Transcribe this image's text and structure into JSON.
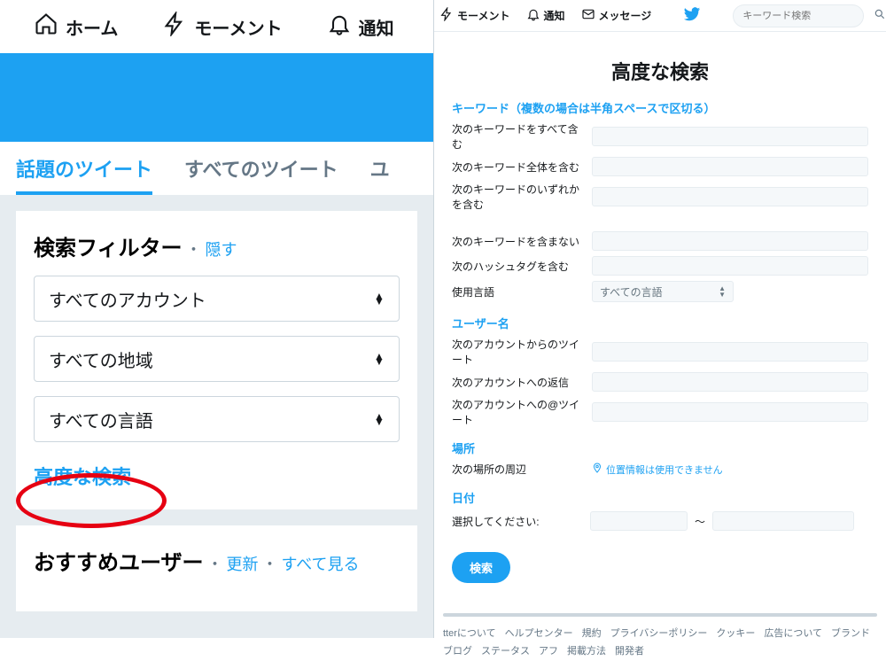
{
  "left": {
    "nav": {
      "home": "ホーム",
      "moments": "モーメント",
      "notifications": "通知"
    },
    "tabs": {
      "hot": "話題のツイート",
      "all": "すべてのツイート",
      "users_cut": "ユ"
    },
    "filter": {
      "title": "検索フィルター",
      "sep": "・",
      "hide": "隠す",
      "sel_account": "すべてのアカウント",
      "sel_region": "すべての地域",
      "sel_lang": "すべての言語",
      "advanced": "高度な検索"
    },
    "recommend": {
      "title": "おすすめユーザー",
      "sep": "・",
      "refresh": "更新",
      "viewall": "すべて見る"
    }
  },
  "right": {
    "top": {
      "moments": "モーメント",
      "notifications": "通知",
      "messages": "メッセージ",
      "search_placeholder": "キーワード検索"
    },
    "title": "高度な検索",
    "sections": {
      "keywords": "キーワード（複数の場合は半角スペースで区切る）",
      "users": "ユーザー名",
      "place": "場所",
      "date": "日付"
    },
    "fields": {
      "kw_all": "次のキーワードをすべて含む",
      "kw_exact": "次のキーワード全体を含む",
      "kw_any": "次のキーワードのいずれかを含む",
      "kw_none": "次のキーワードを含まない",
      "kw_hashtag": "次のハッシュタグを含む",
      "kw_lang": "使用言語",
      "lang_value": "すべての言語",
      "u_from": "次のアカウントからのツイート",
      "u_to": "次のアカウントへの返信",
      "u_mention": "次のアカウントへの@ツイート",
      "place_near": "次の場所の周辺",
      "loc_unavail": "位置情報は使用できません",
      "date_select": "選択してください:",
      "date_sep": "～",
      "submit": "検索"
    },
    "footer": {
      "links": [
        "tterについて",
        "ヘルプセンター",
        "規約",
        "プライバシーポリシー",
        "クッキー",
        "広告について",
        "ブランド",
        "ブログ",
        "ステータス",
        "アフ",
        "掲載方法",
        "開発者"
      ]
    }
  }
}
